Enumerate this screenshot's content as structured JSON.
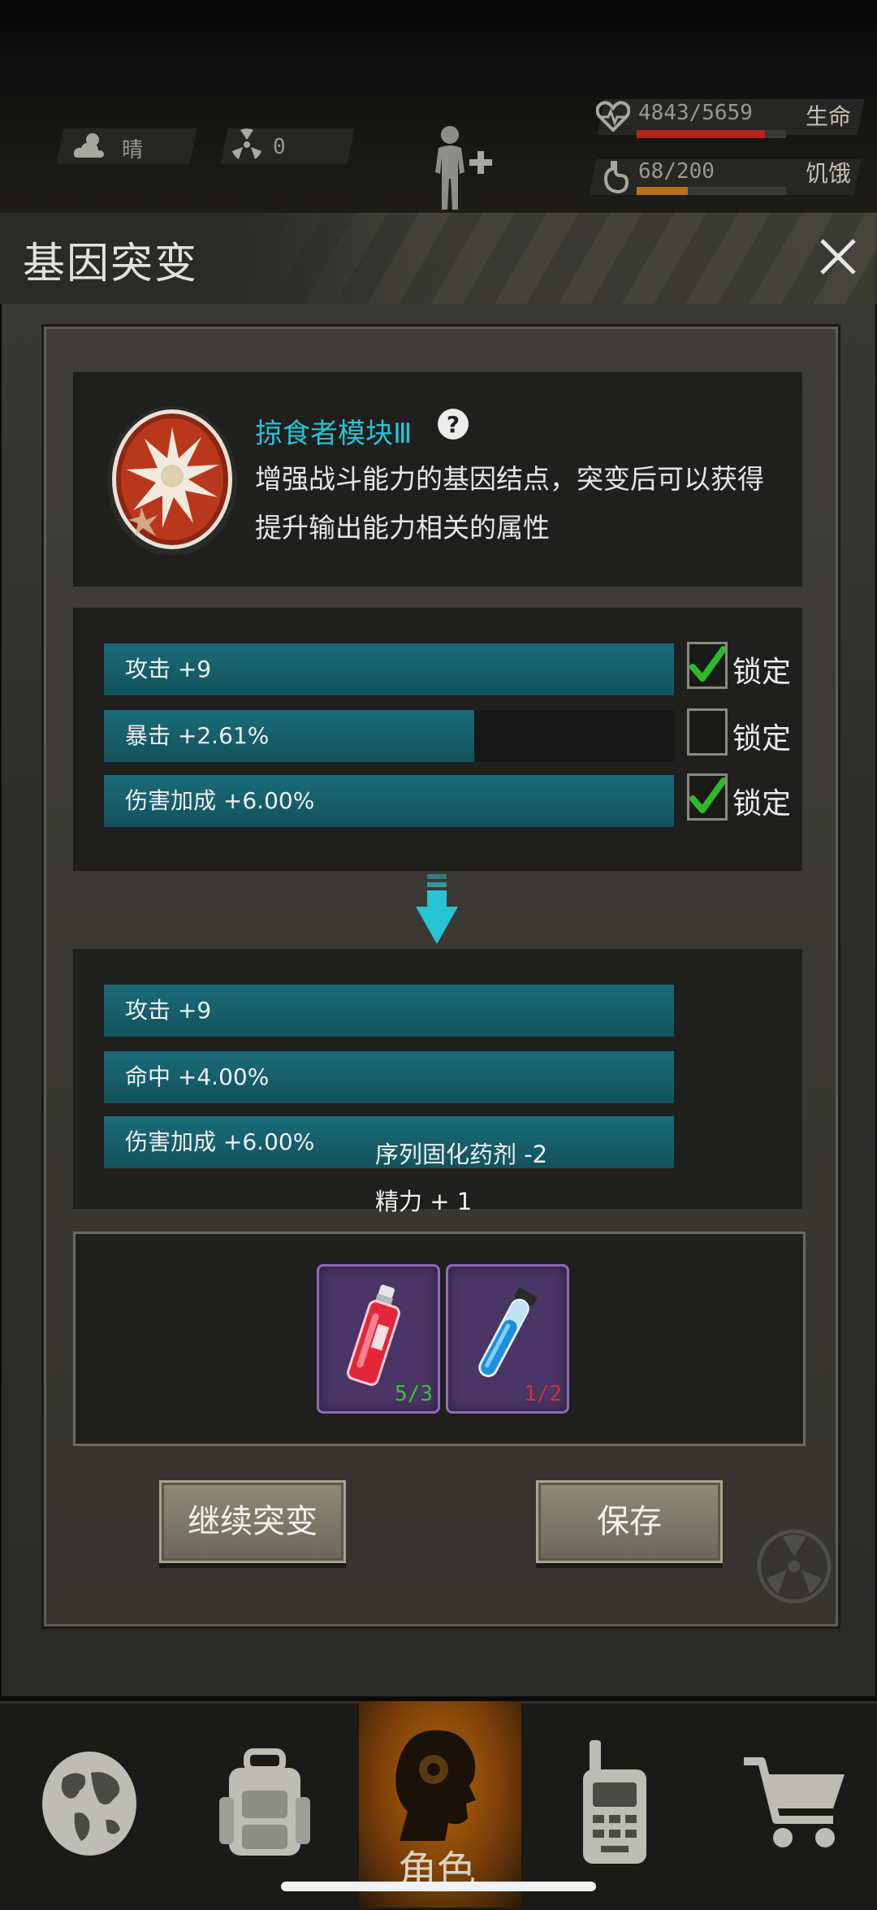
{
  "hud": {
    "weather_icon": "cloud-sun-icon",
    "weather": "晴",
    "radiation_icon": "radiation-icon",
    "radiation": "0",
    "health_value": "4843/5659",
    "health_label": "生命",
    "health_fraction": 0.856,
    "hunger_value": "68/200",
    "hunger_label": "饥饿",
    "hunger_fraction": 0.34,
    "health_color": "#b3241f",
    "hunger_color": "#b86f1a"
  },
  "dialog": {
    "title": "基因突变",
    "close_icon": "close-icon"
  },
  "gene": {
    "name": "掠食者模块Ⅲ",
    "help_icon": "question-icon",
    "description_line1": "增强战斗能力的基因结点，突变后可以获得",
    "description_line2": "提升输出能力相关的属性"
  },
  "current_attributes": [
    {
      "label": "攻击 +9",
      "fill": 1.0,
      "locked": true,
      "lock_label": "锁定"
    },
    {
      "label": "暴击 +2.61%",
      "fill": 0.65,
      "locked": false,
      "lock_label": "锁定"
    },
    {
      "label": "伤害加成 +6.00%",
      "fill": 1.0,
      "locked": true,
      "lock_label": "锁定"
    }
  ],
  "new_attributes": [
    {
      "label": "攻击 +9",
      "fill": 1.0
    },
    {
      "label": "命中 +4.00%",
      "fill": 1.0
    },
    {
      "label": "伤害加成 +6.00%",
      "fill": 1.0
    }
  ],
  "floating": {
    "consume_text": "序列固化药剂 -2",
    "gain_text": "精力 + 1"
  },
  "items": [
    {
      "icon": "red-vial-icon",
      "count": "5/3",
      "count_color": "#35c235"
    },
    {
      "icon": "blue-test-tube-icon",
      "count": "1/2",
      "count_color": "#d23030"
    }
  ],
  "buttons": {
    "continue": "继续突变",
    "save": "保存"
  },
  "nav": {
    "items": [
      "globe-icon",
      "backpack-icon",
      "character-icon",
      "radio-icon",
      "cart-icon"
    ],
    "selected_label": "角色"
  }
}
